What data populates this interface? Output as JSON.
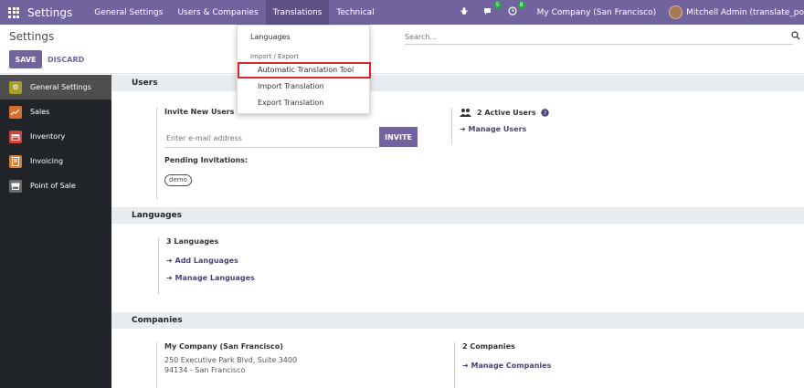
{
  "navbar": {
    "brand": "Settings",
    "menus": [
      "General Settings",
      "Users & Companies",
      "Translations",
      "Technical"
    ],
    "chat_badge": "5",
    "activity_badge": "8",
    "company": "My Company (San Francisco)",
    "user": "Mitchell Admin (translate_po"
  },
  "control": {
    "title": "Settings",
    "save_label": "SAVE",
    "discard_label": "DISCARD",
    "search_placeholder": "Search..."
  },
  "sidebar": {
    "items": [
      {
        "label": "General Settings",
        "color": "#a59f2c"
      },
      {
        "label": "Sales",
        "color": "#d86e2e"
      },
      {
        "label": "Inventory",
        "color": "#d0453b"
      },
      {
        "label": "Invoicing",
        "color": "#d8803a"
      },
      {
        "label": "Point of Sale",
        "color": "#6b6b6b"
      }
    ]
  },
  "dropdown": {
    "languages": "Languages",
    "header": "Import / Export",
    "auto_tool": "Automatic Translation Tool",
    "import": "Import Translation",
    "export": "Export Translation"
  },
  "users": {
    "title": "Users",
    "invite_label": "Invite New Users",
    "email_placeholder": "Enter e-mail address",
    "invite_btn": "INVITE",
    "pending": "Pending Invitations:",
    "pill": "demo",
    "active_users": "2 Active Users",
    "manage_users": "Manage Users"
  },
  "languages": {
    "title": "Languages",
    "count": "3 Languages",
    "add": "Add Languages",
    "manage": "Manage Languages"
  },
  "companies": {
    "title": "Companies",
    "name": "My Company (San Francisco)",
    "address1": "250 Executive Park Blvd, Suite 3400",
    "address2": "94134 - San Francisco",
    "count": "2 Companies",
    "manage": "Manage Companies"
  }
}
